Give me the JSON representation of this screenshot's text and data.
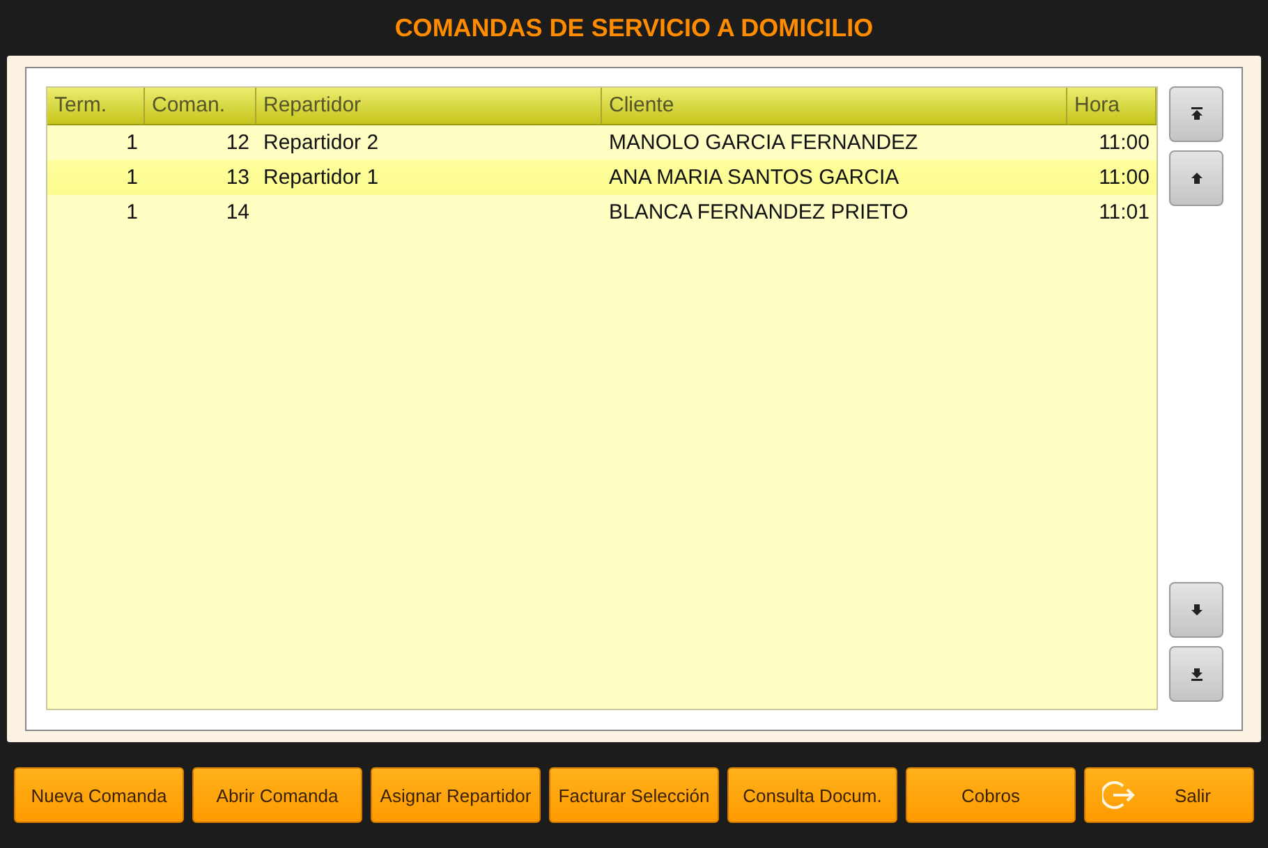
{
  "window": {
    "title": "COMANDAS DE SERVICIO A DOMICILIO"
  },
  "table": {
    "columns": [
      "Term.",
      "Coman.",
      "Repartidor",
      "Cliente",
      "Hora"
    ],
    "rows": [
      {
        "cells": [
          "1",
          "12",
          "Repartidor 2",
          "MANOLO GARCIA FERNANDEZ",
          "11:00"
        ],
        "selected": false
      },
      {
        "cells": [
          "1",
          "13",
          "Repartidor 1",
          "ANA MARIA SANTOS GARCIA",
          "11:00"
        ],
        "selected": true
      },
      {
        "cells": [
          "1",
          "14",
          "",
          "BLANCA FERNANDEZ PRIETO",
          "11:01"
        ],
        "selected": false
      }
    ]
  },
  "scroll_buttons": [
    {
      "kind": "top"
    },
    {
      "kind": "up"
    },
    {
      "kind": "down"
    },
    {
      "kind": "bottom"
    }
  ],
  "buttons": [
    {
      "label": "Nueva Comanda",
      "kind": "text"
    },
    {
      "label": "Abrir Comanda",
      "kind": "text"
    },
    {
      "label": "Asignar Repartidor",
      "kind": "text"
    },
    {
      "label": "Facturar Selección",
      "kind": "text"
    },
    {
      "label": "Consulta Docum.",
      "kind": "text"
    },
    {
      "label": "Cobros",
      "kind": "text"
    },
    {
      "label": "Salir",
      "kind": "exit"
    }
  ]
}
